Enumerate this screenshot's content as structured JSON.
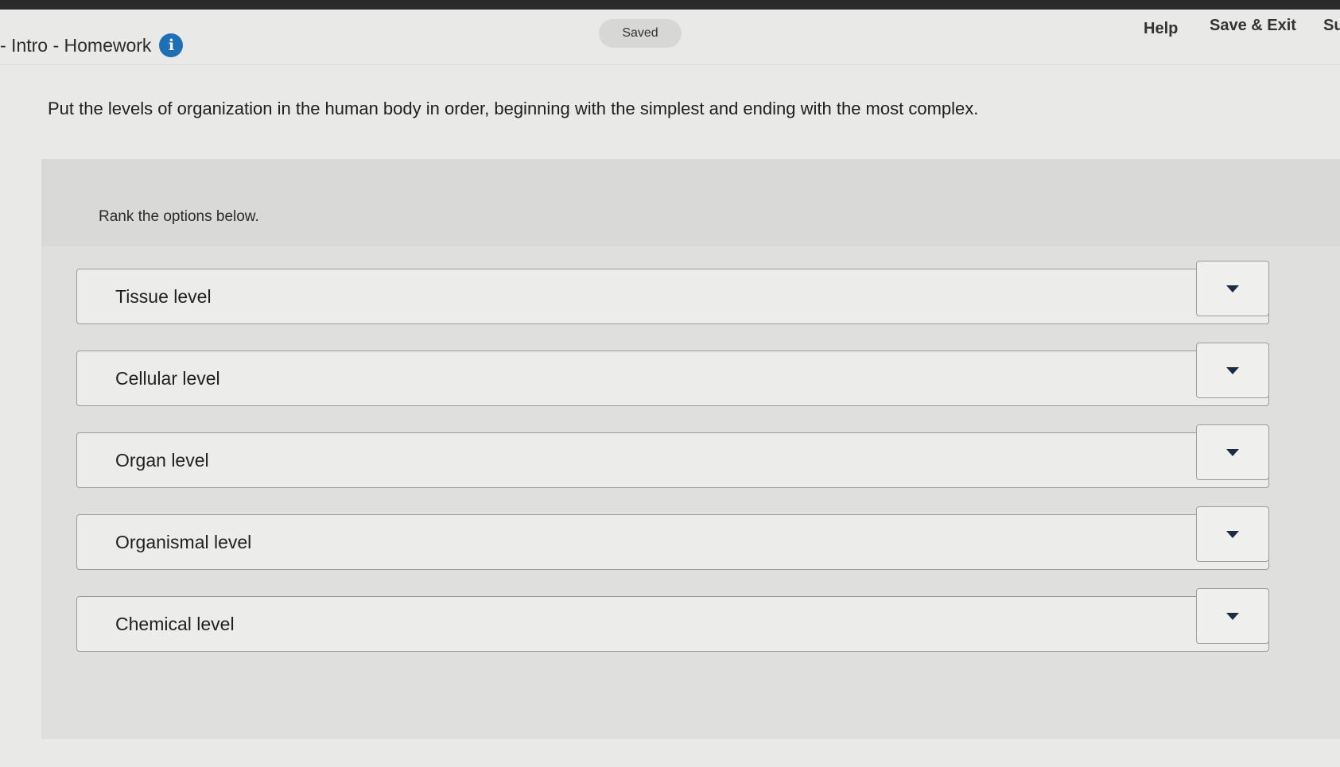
{
  "header": {
    "assignment_title": "- Intro - Homework",
    "info_icon": "info-icon",
    "saved_status": "Saved",
    "help_label": "Help",
    "save_exit_label": "Save & Exit",
    "submit_partial_label": "Su"
  },
  "question": {
    "prompt": "Put the levels of organization in the human body in order, beginning with the simplest and ending with the most complex."
  },
  "ranking": {
    "instruction": "Rank the options below.",
    "dropdown_icon": "caret-down-icon",
    "items": [
      {
        "label": "Tissue level"
      },
      {
        "label": "Cellular level"
      },
      {
        "label": "Organ level"
      },
      {
        "label": "Organismal level"
      },
      {
        "label": "Chemical level"
      }
    ]
  },
  "colors": {
    "info_icon": "#1f6fb7",
    "caret": "#1c2c45",
    "top_strip": "#2a2a2a"
  }
}
